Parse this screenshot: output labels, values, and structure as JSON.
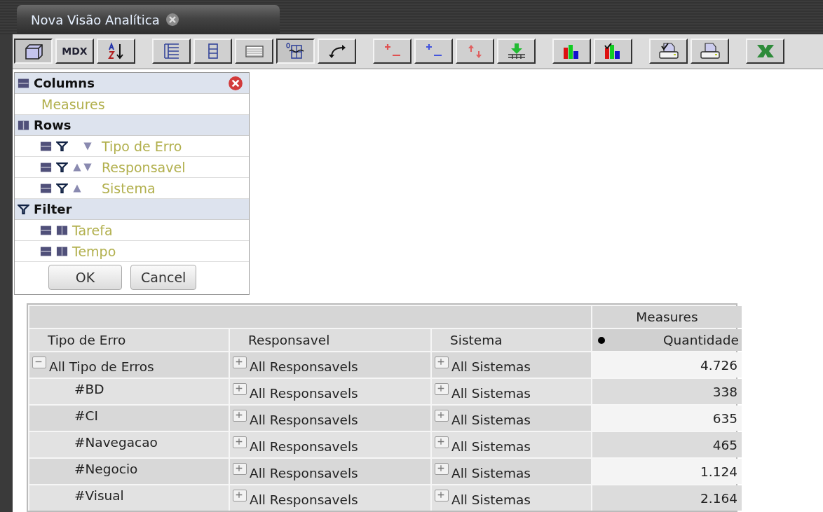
{
  "tab": {
    "title": "Nova Visão Analítica"
  },
  "toolbar": [
    {
      "buttons": [
        {
          "kind": "cube",
          "pressed": true
        },
        {
          "kind": "mdx",
          "label": "MDX",
          "pressed": false
        },
        {
          "kind": "sort",
          "pressed": false
        }
      ]
    },
    {
      "buttons": [
        {
          "kind": "tree",
          "pressed": false
        },
        {
          "kind": "column",
          "pressed": false
        },
        {
          "kind": "table",
          "pressed": false
        },
        {
          "kind": "zero-grid",
          "pressed": true
        },
        {
          "kind": "swap",
          "pressed": false
        }
      ]
    },
    {
      "buttons": [
        {
          "kind": "plus-minus",
          "pressed": false
        },
        {
          "kind": "plus-minus-alt",
          "pressed": false
        },
        {
          "kind": "up-down",
          "pressed": false
        },
        {
          "kind": "drill",
          "pressed": false
        }
      ]
    },
    {
      "buttons": [
        {
          "kind": "chart",
          "pressed": false
        },
        {
          "kind": "chart-check",
          "pressed": false
        }
      ]
    },
    {
      "buttons": [
        {
          "kind": "print-check",
          "pressed": false
        },
        {
          "kind": "print",
          "pressed": false
        }
      ]
    },
    {
      "buttons": [
        {
          "kind": "excel",
          "pressed": false
        }
      ]
    }
  ],
  "panel": {
    "sections": [
      {
        "kind": "columns",
        "title": "Columns",
        "items": [
          {
            "kind": "measure",
            "label": "Measures"
          }
        ]
      },
      {
        "kind": "rows",
        "title": "Rows",
        "items": [
          {
            "kind": "dimension",
            "label": "Tipo de Erro",
            "sort_ascending": false,
            "sort_descending": true
          },
          {
            "kind": "dimension",
            "label": "Responsavel",
            "sort_ascending": true,
            "sort_descending": true
          },
          {
            "kind": "dimension",
            "label": "Sistema",
            "sort_ascending": true,
            "sort_descending": false
          }
        ]
      },
      {
        "kind": "filter",
        "title": "Filter",
        "items": [
          {
            "kind": "filter-dimension",
            "label": "Tarefa"
          },
          {
            "kind": "filter-dimension",
            "label": "Tempo"
          }
        ]
      }
    ],
    "buttons": [
      "OK",
      "Cancel"
    ]
  },
  "table": {
    "measures_header": "Measures",
    "columns": [
      "Tipo de Erro",
      "Responsavel",
      "Sistema"
    ],
    "measure": "Quantidade",
    "rows": [
      {
        "label": "All Tipo de Erros",
        "expanded": true,
        "responsavel": "All Responsavels",
        "sistema": "All Sistemas",
        "value": "4.726",
        "children": [
          {
            "label": "#BD",
            "responsavel": "All Responsavels",
            "sistema": "All Sistemas",
            "value": "338"
          },
          {
            "label": "#CI",
            "responsavel": "All Responsavels",
            "sistema": "All Sistemas",
            "value": "635"
          },
          {
            "label": "#Navegacao",
            "responsavel": "All Responsavels",
            "sistema": "All Sistemas",
            "value": "465"
          },
          {
            "label": "#Negocio",
            "responsavel": "All Responsavels",
            "sistema": "All Sistemas",
            "value": "1.124"
          },
          {
            "label": "#Visual",
            "responsavel": "All Responsavels",
            "sistema": "All Sistemas",
            "value": "2.164"
          }
        ]
      }
    ]
  }
}
